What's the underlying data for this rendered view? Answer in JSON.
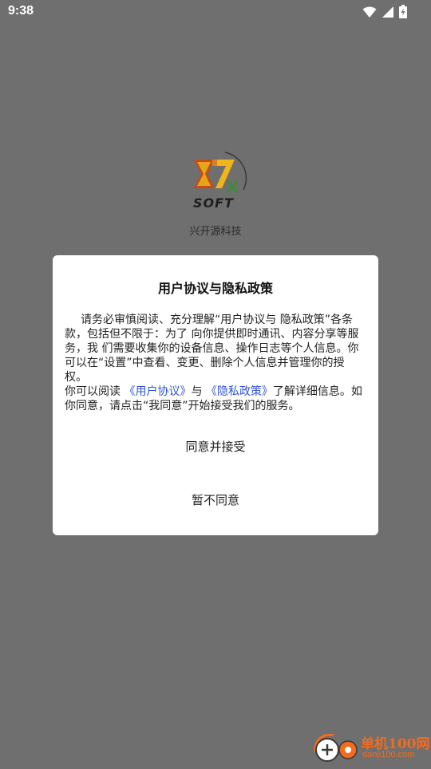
{
  "status_bar": {
    "time": "9:38",
    "icons": [
      "wifi-icon",
      "signal-icon",
      "battery-charging-icon"
    ]
  },
  "splash": {
    "logo_text": "SOFT",
    "app_name": "兴开源科技"
  },
  "dialog": {
    "title": "用户协议与隐私政策",
    "body_line1": "请务必审慎阅读、充分理解“用户协议与 隐私政策”各条款，包括但不限于：为了 向你提供即时通讯、内容分享等服务，我 们需要收集你的设备信息、操作日志等个人信息。你可以在“设置”中查看、变更、删除个人信息并管理你的授权。",
    "body_line2_prefix": "你可以阅读 ",
    "link_user_agreement": "《用户协议》",
    "body_line2_mid": "与 ",
    "link_privacy_policy": "《隐私政策》",
    "body_line2_suffix": "了解详细信息。如你同意，请点击“我同意”开始接受我们的服务。",
    "accept_label": "同意并接受",
    "decline_label": "暂不同意"
  },
  "watermark": {
    "site_name": "单机100网",
    "site_url": "danji100.com"
  },
  "colors": {
    "overlay": "#6f6f6f",
    "link": "#2f55d4",
    "watermark": "#f36b1c"
  }
}
